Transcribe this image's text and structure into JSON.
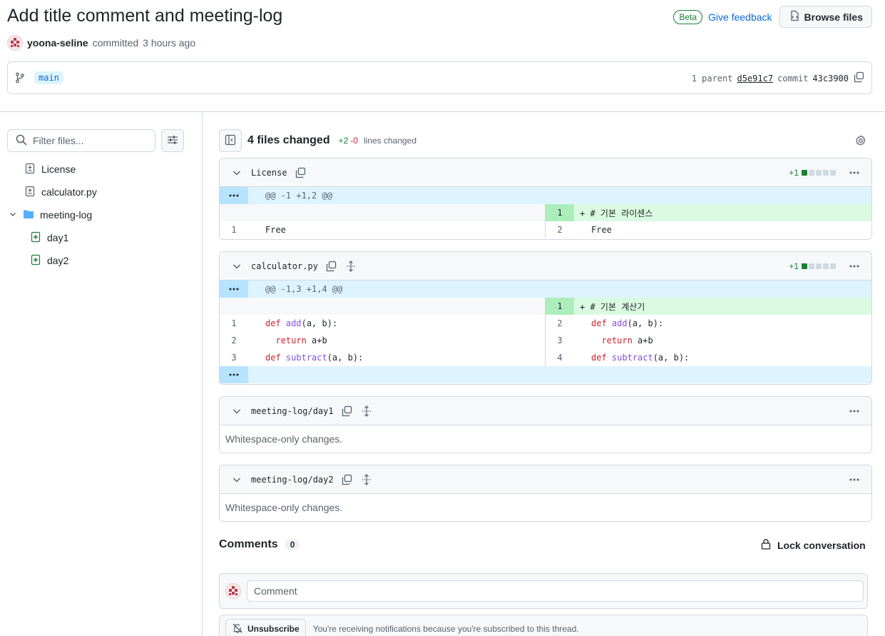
{
  "header": {
    "title": "Add title comment and meeting-log",
    "beta": "Beta",
    "feedback": "Give feedback",
    "browse_files": "Browse files"
  },
  "author": {
    "name": "yoona-seline",
    "action": "committed",
    "time": "3 hours ago"
  },
  "commit": {
    "branch": "main",
    "parent_label": "1 parent",
    "parent_hash": "d5e91c7",
    "commit_label": "commit",
    "commit_hash": "43c3900"
  },
  "sidebar": {
    "filter_placeholder": "Filter files...",
    "tree": [
      {
        "label": "License",
        "type": "file",
        "status": "modified"
      },
      {
        "label": "calculator.py",
        "type": "file",
        "status": "modified"
      },
      {
        "label": "meeting-log",
        "type": "folder"
      },
      {
        "label": "day1",
        "type": "file",
        "status": "added"
      },
      {
        "label": "day2",
        "type": "file",
        "status": "added"
      }
    ]
  },
  "summary": {
    "files_changed": "4 files changed",
    "additions": "+2",
    "deletions": "-0",
    "lines_changed": "lines changed"
  },
  "files": [
    {
      "name": "License",
      "diffstat": "+1",
      "hunk": "@@ -1 +1,2 @@",
      "rows": [
        {
          "left_ln": "",
          "left_code": "",
          "right_ln": "1",
          "right_code": "+ # 기본 라이센스"
        },
        {
          "left_ln": "1",
          "left_code": "Free",
          "right_ln": "2",
          "right_code": "Free"
        }
      ]
    },
    {
      "name": "calculator.py",
      "diffstat": "+1",
      "hunk": "@@ -1,3 +1,4 @@",
      "rows": [
        {
          "left_ln": "",
          "left_code": "",
          "right_ln": "1",
          "right_code": "+ # 기본 계산기"
        },
        {
          "left_ln": "1",
          "left_kw": "def ",
          "left_fn": "add",
          "left_rest": "(a, b):",
          "right_ln": "2",
          "right_kw": "def ",
          "right_fn": "add",
          "right_rest": "(a, b):"
        },
        {
          "left_ln": "2",
          "left_kw": "return ",
          "left_rest": "a+b",
          "right_ln": "3",
          "right_kw": "return ",
          "right_rest": "a+b"
        },
        {
          "left_ln": "3",
          "left_kw": "def ",
          "left_fn": "subtract",
          "left_rest": "(a, b):",
          "right_ln": "4",
          "right_kw": "def ",
          "right_fn": "subtract",
          "right_rest": "(a, b):"
        }
      ]
    },
    {
      "name": "meeting-log/day1",
      "message": "Whitespace-only changes."
    },
    {
      "name": "meeting-log/day2",
      "message": "Whitespace-only changes."
    }
  ],
  "comments": {
    "title": "Comments",
    "count": "0",
    "lock": "Lock conversation",
    "placeholder": "Comment",
    "unsubscribe": "Unsubscribe",
    "subscription_note": "You're receiving notifications because you're subscribed to this thread."
  },
  "colors": {
    "accent": "#0969da",
    "added": "#1a7f37",
    "deleted": "#d1242f",
    "hunk_bg": "#ddf4ff",
    "add_bg": "#dafbe1"
  }
}
